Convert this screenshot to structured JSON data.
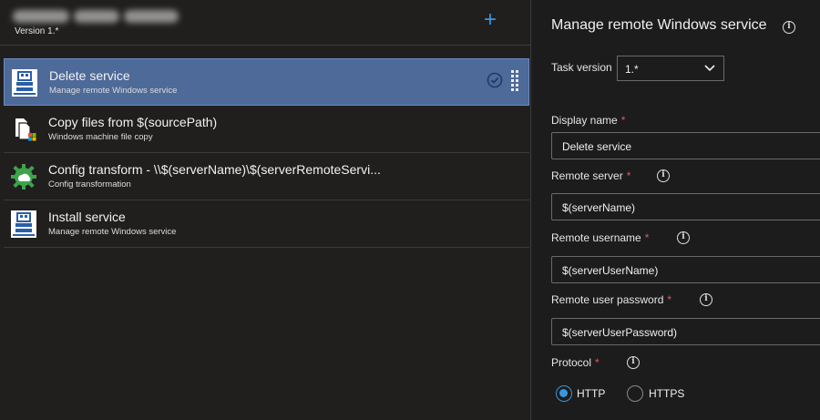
{
  "pipeline": {
    "version_label": "Version 1.*"
  },
  "toolbar": {
    "add_label": "+"
  },
  "tasks": [
    {
      "title": "Delete service",
      "subtitle": "Manage remote Windows service",
      "icon": "service-icon",
      "selected": true
    },
    {
      "title": "Copy files from $(sourcePath)",
      "subtitle": "Windows machine file copy",
      "icon": "file-copy-icon",
      "selected": false
    },
    {
      "title": "Config transform - \\\\$(serverName)\\$(serverRemoteServi...",
      "subtitle": "Config transformation",
      "icon": "config-transform-icon",
      "selected": false
    },
    {
      "title": "Install service",
      "subtitle": "Manage remote Windows service",
      "icon": "service-icon",
      "selected": false
    }
  ],
  "panel": {
    "title": "Manage remote Windows service",
    "task_version_label": "Task version",
    "task_version_value": "1.*",
    "display_name_label": "Display name",
    "display_name_value": "Delete service",
    "remote_server_label": "Remote server",
    "remote_server_value": "$(serverName)",
    "remote_username_label": "Remote username",
    "remote_username_value": "$(serverUserName)",
    "remote_password_label": "Remote user password",
    "remote_password_value": "$(serverUserPassword)",
    "protocol_label": "Protocol",
    "required_mark": "*",
    "info_glyph": "i",
    "protocol_options": [
      "HTTP",
      "HTTPS"
    ],
    "protocol_selected": "HTTP"
  },
  "colors": {
    "accent": "#3a96dd",
    "selected_row": "#4d6a98",
    "required": "#e05a5a",
    "background": "#1f1f1f"
  }
}
